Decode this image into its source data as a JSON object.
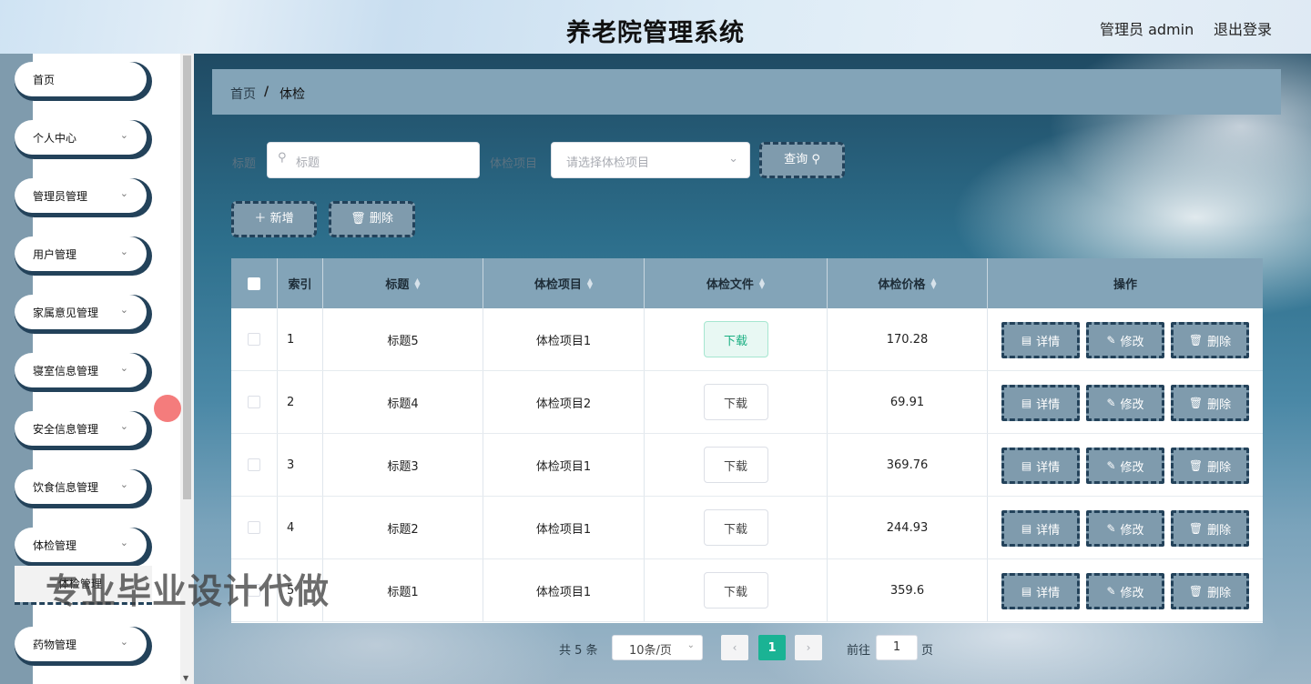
{
  "header": {
    "title": "养老院管理系统",
    "user": "管理员 admin",
    "logout": "退出登录"
  },
  "sidebar": {
    "items": [
      {
        "label": "首页",
        "has_arrow": false
      },
      {
        "label": "个人中心",
        "has_arrow": true
      },
      {
        "label": "管理员管理",
        "has_arrow": true
      },
      {
        "label": "用户管理",
        "has_arrow": true
      },
      {
        "label": "家属意见管理",
        "has_arrow": true
      },
      {
        "label": "寝室信息管理",
        "has_arrow": true
      },
      {
        "label": "安全信息管理",
        "has_arrow": true
      },
      {
        "label": "饮食信息管理",
        "has_arrow": true
      },
      {
        "label": "体检管理",
        "has_arrow": true
      },
      {
        "label": "体检管理",
        "has_arrow": false
      },
      {
        "label": "药物管理",
        "has_arrow": true
      }
    ]
  },
  "watermark": "专业毕业设计代做",
  "breadcrumb": {
    "home": "首页",
    "sep": "/",
    "current": "体检"
  },
  "search": {
    "label1": "标题",
    "input1_placeholder": "标题",
    "label2": "体检项目",
    "select_placeholder": "请选择体检项目",
    "query_label": "查询"
  },
  "actions": {
    "add": "新增",
    "delete": "删除"
  },
  "table": {
    "headers": {
      "index": "索引",
      "title": "标题",
      "item": "体检项目",
      "file": "体检文件",
      "price": "体检价格",
      "ops": "操作"
    },
    "download_label": "下载",
    "ops": {
      "detail": "详情",
      "edit": "修改",
      "delete": "删除"
    },
    "rows": [
      {
        "index": "1",
        "title": "标题5",
        "item": "体检项目1",
        "price": "170.28"
      },
      {
        "index": "2",
        "title": "标题4",
        "item": "体检项目2",
        "price": "69.91"
      },
      {
        "index": "3",
        "title": "标题3",
        "item": "体检项目1",
        "price": "369.76"
      },
      {
        "index": "4",
        "title": "标题2",
        "item": "体检项目1",
        "price": "244.93"
      },
      {
        "index": "5",
        "title": "标题1",
        "item": "体检项目1",
        "price": "359.6"
      }
    ]
  },
  "pagination": {
    "total": "共 5 条",
    "page_size": "10条/页",
    "current": "1",
    "goto_prefix": "前往",
    "goto_value": "1",
    "goto_suffix": "页"
  }
}
